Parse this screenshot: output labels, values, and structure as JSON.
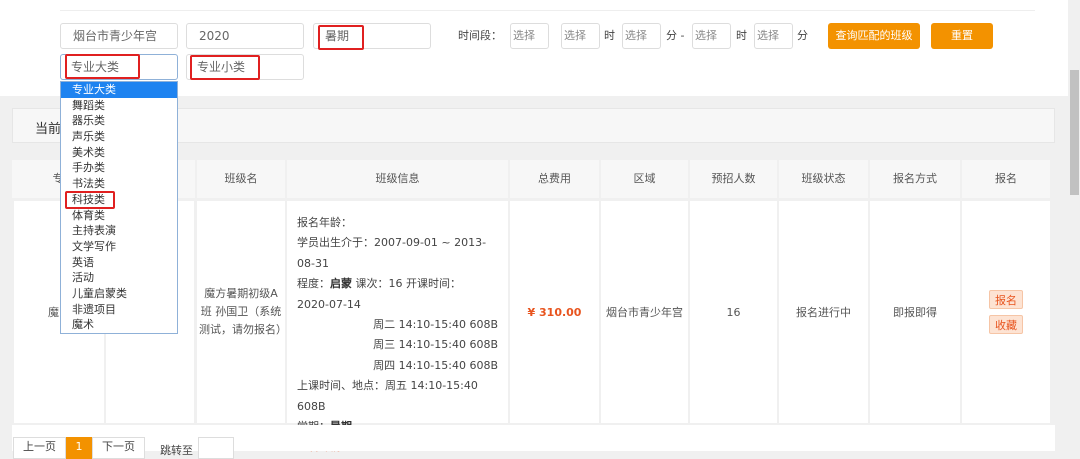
{
  "filters": {
    "venue": "烟台市青少年宫",
    "year": "2020",
    "term": "暑期",
    "major_category": "专业大类",
    "minor_category": "专业小类",
    "time_label": "时间段：",
    "select_placeholder": "选择",
    "hour_label": "时",
    "minute_dash_label": "分 -",
    "minute_label": "分",
    "search_button": "查询匹配的班级",
    "reset_button": "重置"
  },
  "dropdown": {
    "options": [
      "专业大类",
      "舞蹈类",
      "器乐类",
      "声乐类",
      "美术类",
      "手办类",
      "书法类",
      "科技类",
      "体育类",
      "主持表演",
      "文学写作",
      "英语",
      "活动",
      "儿童启蒙类",
      "非遗项目",
      "魔术"
    ],
    "selected": "专业大类",
    "highlighted": "科技类"
  },
  "current_panel": {
    "title": "当前"
  },
  "table": {
    "headers": [
      "专",
      "",
      "班级名",
      "班级信息",
      "总费用",
      "区域",
      "预招人数",
      "班级状态",
      "报名方式",
      "报名"
    ],
    "row": {
      "col1": "魔",
      "class_name": "魔方暑期初级A班 孙国卫（系统测试，请勿报名）",
      "info": {
        "age_label": "报名年龄：",
        "birth": "学员出生介于：2007-09-01 ~ 2013-08-31",
        "level_label": "程度：",
        "level": "启蒙",
        "lessons": " 课次：16  开课时间：",
        "start_date": "2020-07-14",
        "schedule": [
          "周二 14:10-15:40 608B",
          "周三 14:10-15:40 608B",
          "周四 14:10-15:40 608B"
        ],
        "place_label": "上课时间、地点：",
        "last_schedule": "周五 14:10-15:40 608B",
        "term_label": "学期：",
        "term": "暑期",
        "detail_link": "查看详情>>"
      },
      "fee": "¥ 310.00",
      "region": "烟台市青少年宫",
      "quota": "16",
      "status": "报名进行中",
      "method": "即报即得",
      "enroll_button": "报名",
      "favorite_button": "收藏"
    }
  },
  "pagination": {
    "prev": "上一页",
    "current": "1",
    "next": "下一页",
    "jump_label": "跳转至"
  }
}
